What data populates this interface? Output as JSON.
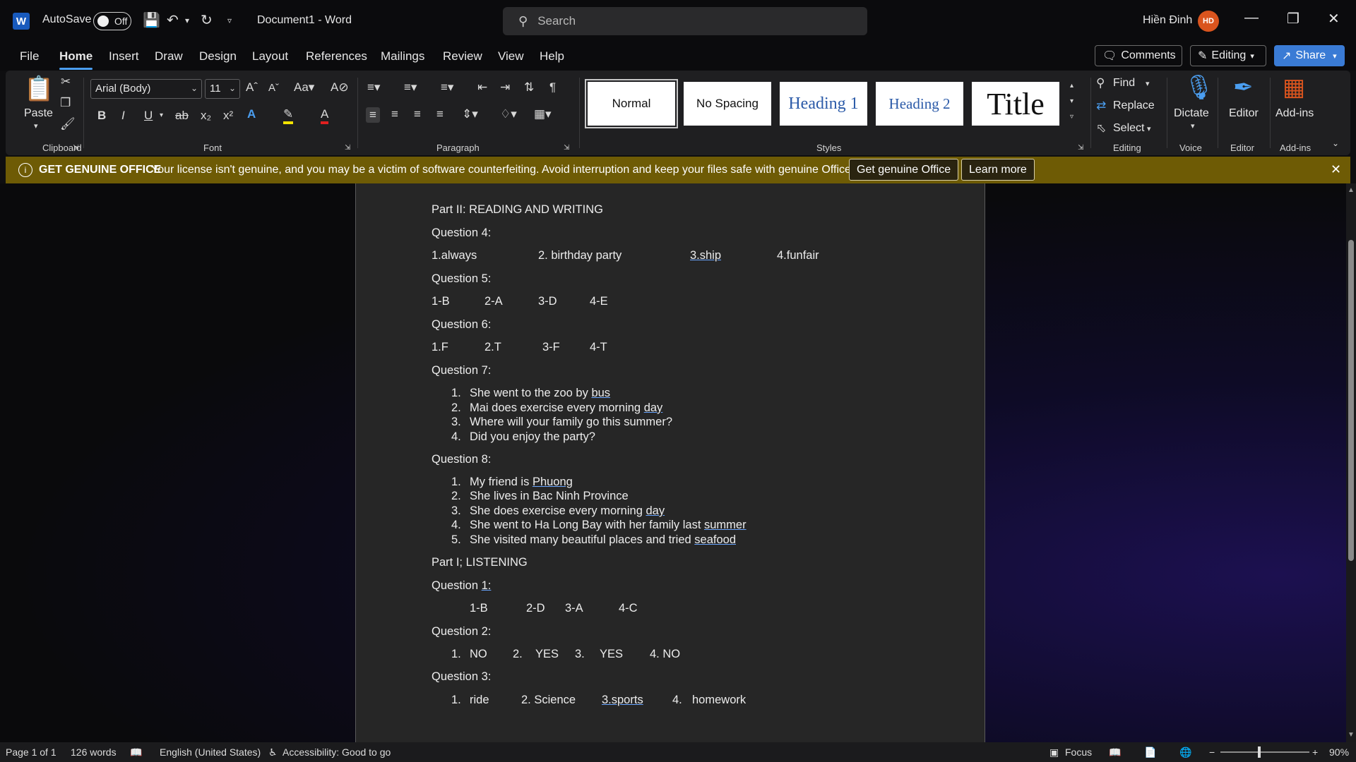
{
  "app": {
    "autosave_label": "AutoSave",
    "autosave_state": "Off",
    "doc_title": "Document1  -  Word",
    "search_placeholder": "Search",
    "user_name": "Hiền Đinh",
    "user_initials": "HD"
  },
  "tabs": [
    "File",
    "Home",
    "Insert",
    "Draw",
    "Design",
    "Layout",
    "References",
    "Mailings",
    "Review",
    "View",
    "Help"
  ],
  "active_tab": "Home",
  "right_buttons": {
    "comments": "Comments",
    "editing": "Editing",
    "share": "Share"
  },
  "ribbon": {
    "clipboard": {
      "label": "Clipboard",
      "paste": "Paste"
    },
    "font": {
      "label": "Font",
      "family": "Arial (Body)",
      "size": "11"
    },
    "paragraph": {
      "label": "Paragraph"
    },
    "styles": {
      "label": "Styles",
      "items": [
        "Normal",
        "No Spacing",
        "Heading 1",
        "Heading 2",
        "Title"
      ],
      "selected": "Normal"
    },
    "editing": {
      "label": "Editing",
      "find": "Find",
      "replace": "Replace",
      "select": "Select"
    },
    "voice": {
      "label": "Voice",
      "dictate": "Dictate"
    },
    "editor": {
      "label": "Editor",
      "button": "Editor"
    },
    "addins": {
      "label": "Add-ins",
      "button": "Add-ins"
    }
  },
  "notice": {
    "title": "GET GENUINE OFFICE",
    "message": "Your license isn't genuine, and you may be a victim of software counterfeiting. Avoid interruption and keep your files safe with genuine Office today.",
    "btn_genuine": "Get genuine Office",
    "btn_learn": "Learn more"
  },
  "document": {
    "part2": "Part II: READING AND WRITING",
    "q4": "Question 4:",
    "q4_answers": [
      "1.always",
      "2. birthday party",
      "3.ship",
      "4.funfair"
    ],
    "q5": "Question 5:",
    "q5_answers": [
      "1-B",
      "2-A",
      "3-D",
      "4-E"
    ],
    "q6": "Question 6:",
    "q6_answers": [
      "1.F",
      "2.T",
      "3-F",
      "4-T"
    ],
    "q7": "Question 7:",
    "q7_items": [
      {
        "num": "1.",
        "text": "She went to the zoo by ",
        "u": "bus"
      },
      {
        "num": "2.",
        "text": "Mai does exercise every morning ",
        "u": "day"
      },
      {
        "num": "3.",
        "text": "Where will your family go this summer?",
        "u": ""
      },
      {
        "num": "4.",
        "text": "Did you enjoy the party?",
        "u": ""
      }
    ],
    "q8": "Question 8:",
    "q8_items": [
      {
        "num": "1.",
        "text": "My friend is ",
        "u": "Phuong"
      },
      {
        "num": "2.",
        "text": "She lives in Bac Ninh Province",
        "u": ""
      },
      {
        "num": "3.",
        "text": "She does exercise every morning ",
        "u": "day"
      },
      {
        "num": "4.",
        "text": "She went to Ha Long Bay with her family last ",
        "u": "summer"
      },
      {
        "num": "5.",
        "text": "She visited many beautiful places and tried ",
        "u": "seafood"
      }
    ],
    "part1": "Part I; LISTENING",
    "q1_prefix": "Question ",
    "q1_u": "1:",
    "q1_answers": [
      "1-B",
      "2-D",
      "3-A",
      "4-C"
    ],
    "q2": "Question 2:",
    "q2_answers": [
      "1.",
      "NO",
      "2.",
      "YES",
      "3.",
      "YES",
      "4. NO"
    ],
    "q3": "Question 3:",
    "q3_answers": [
      "1.",
      "ride",
      "2. Science",
      "3.sports",
      "4.",
      "homework"
    ]
  },
  "status": {
    "page": "Page 1 of 1",
    "words": "126 words",
    "language": "English (United States)",
    "accessibility": "Accessibility: Good to go",
    "focus": "Focus",
    "zoom": "90%"
  }
}
